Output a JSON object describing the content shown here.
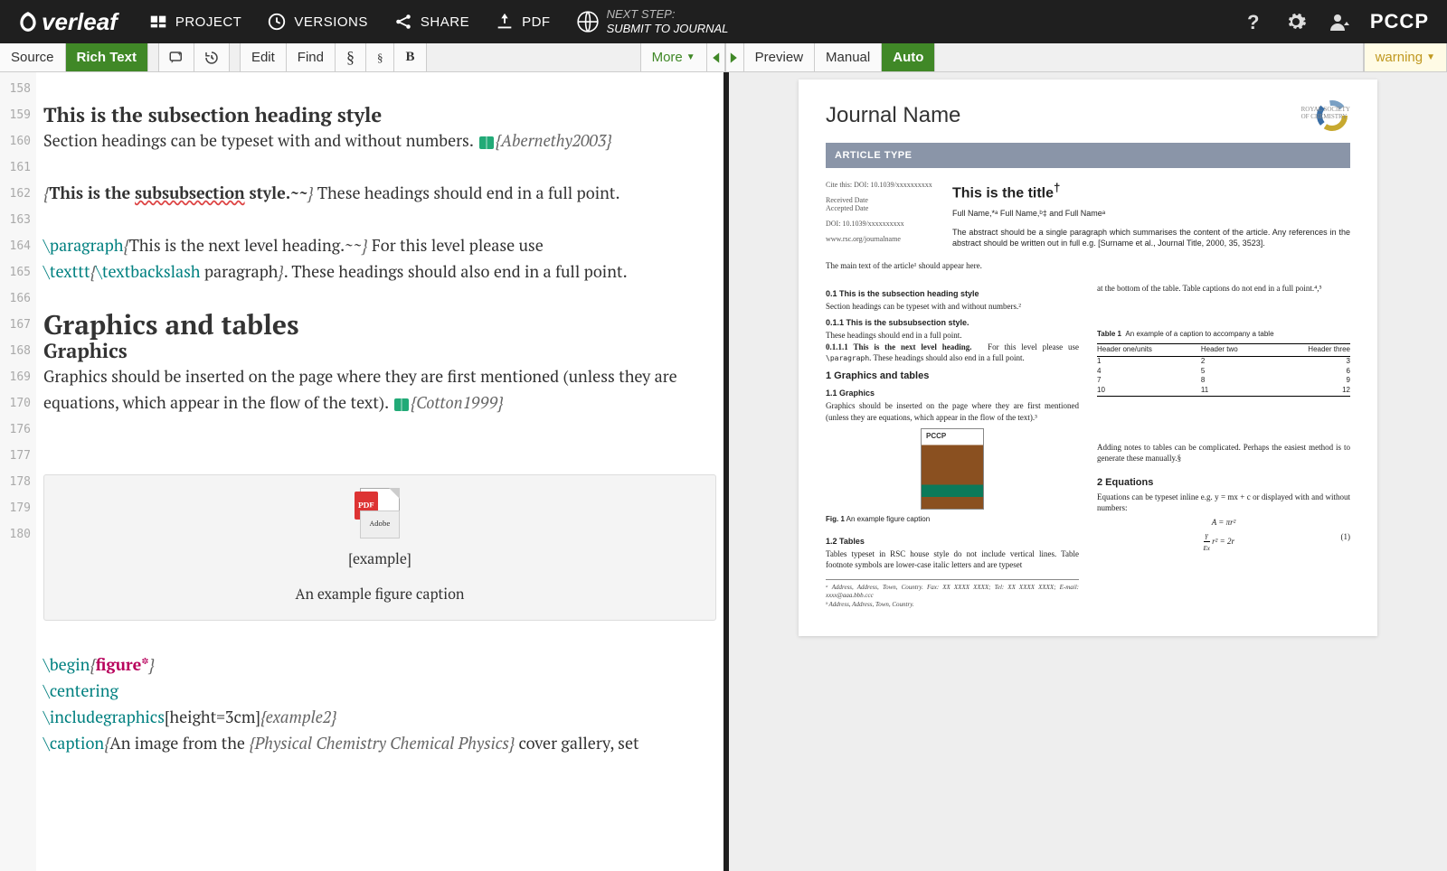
{
  "topbar": {
    "logo": "verleaf",
    "project": "PROJECT",
    "versions": "VERSIONS",
    "share": "SHARE",
    "pdf": "PDF",
    "nextstep_label": "NEXT STEP:",
    "nextstep_action": "SUBMIT TO JOURNAL",
    "brand": "PCCP"
  },
  "toolbar": {
    "source": "Source",
    "richtext": "Rich Text",
    "edit": "Edit",
    "find": "Find",
    "sec": "§",
    "sub": "§",
    "bold": "B",
    "more": "More",
    "preview": "Preview",
    "manual": "Manual",
    "auto": "Auto",
    "warning": "warning"
  },
  "gutter": [
    "158",
    "159",
    "160",
    "161",
    "162",
    "163",
    "164",
    "",
    "165",
    "166",
    "167",
    "168",
    "",
    "169",
    "170",
    "",
    "",
    "",
    "",
    "",
    "176",
    "177",
    "178",
    "179",
    "180"
  ],
  "editor": {
    "l159": "This is the subsection heading style",
    "l160a": "Section headings can be typeset with and without numbers. ",
    "l160b": "{Abernethy2003}",
    "l162a": "{",
    "l162b": "This is the ",
    "l162c": "subsubsection",
    "l162d": " style.~~",
    "l162e": "}",
    "l162f": " These headings should end in a full point.",
    "l164a": "\\paragraph",
    "l164b": "{",
    "l164c": "This is the next level heading.~~",
    "l164d": "}",
    "l164e": " For this level please use ",
    "l164f": "\\texttt",
    "l164g": "{",
    "l164h": "\\textbackslash",
    "l164i": " paragraph",
    "l164j": "}",
    "l164k": ". These headings should also end in a full point.",
    "l166": "Graphics and tables",
    "l167": "Graphics",
    "l168a": "Graphics should be inserted on the page where they are first mentioned (unless they are equations, which appear in the flow of the text). ",
    "l168b": "{Cotton1999}",
    "fig_name": "[example]",
    "fig_caption": "An example figure caption",
    "l177a": "\\begin",
    "l177b": "{",
    "l177c": "figure*",
    "l177d": "}",
    "l178": " \\centering",
    "l179a": " \\includegraphics",
    "l179b": "[height=3cm]",
    "l179c": "{example2}",
    "l180a": " \\caption",
    "l180b": "{",
    "l180c": "An image from the ",
    "l180d": "{Physical Chemistry Chemical Physics}",
    "l180e": " cover gallery, set"
  },
  "preview": {
    "journal_name": "Journal Name",
    "rsc1": "ROYAL SOCIETY",
    "rsc2": "OF CHEMISTRY",
    "article_type": "ARTICLE TYPE",
    "cite": "Cite this: DOI: 10.1039/xxxxxxxxxx",
    "received": "Received Date",
    "accepted": "Accepted Date",
    "doi": "DOI: 10.1039/xxxxxxxxxx",
    "url": "www.rsc.org/journalname",
    "title": "This is the title",
    "title_dag": "†",
    "authors": "Full Name,*ᵃ Full Name,ᵇ‡ and Full Nameᵃ",
    "abstract": "The abstract should be a single paragraph which summarises the content of the article. Any references in the abstract should be written out in full e.g. [Surname et al., Journal Title, 2000, 35, 3523].",
    "intro": "The main text of the article¹ should appear here.",
    "s01": "0.1   This is the subsection heading style",
    "s01t": "Section headings can be typeset with and without numbers.²",
    "s011": "0.1.1   This is the subsubsection style.",
    "s011t": "These headings should end in a full point.",
    "s0111a": "0.1.1.1   This is the next level heading.",
    "s0111b": "For this level please use ",
    "s0111c": "\\paragraph",
    "s0111d": ". These headings should also end in a full point.",
    "s1": "1    Graphics and tables",
    "s11": "1.1   Graphics",
    "s11t": "Graphics should be inserted on the page where they are first mentioned (unless they are equations, which appear in the flow of the text).³",
    "figcap": "Fig. 1 An example figure caption",
    "s12": "1.2   Tables",
    "s12t": "Tables typeset in RSC house style do not include vertical lines. Table footnote symbols are lower-case italic letters and are typeset",
    "col2_top": "at the bottom of the table. Table captions do not end in a full point.⁴,⁵",
    "tabcap": "Table 1   An example of a caption to accompany a table",
    "th1": "Header one/units",
    "th2": "Header two",
    "th3": "Header three",
    "r1c1": "1",
    "r1c2": "2",
    "r1c3": "3",
    "r2c1": "4",
    "r2c2": "5",
    "r2c3": "6",
    "r3c1": "7",
    "r3c2": "8",
    "r3c3": "9",
    "r4c1": "10",
    "r4c2": "11",
    "r4c3": "12",
    "notes": "Adding notes to tables can be complicated. Perhaps the easiest method is to generate these manually.§",
    "s2": "2    Equations",
    "s2t": "Equations can be typeset inline e.g.  y = mx + c or displayed with and without numbers:",
    "eq1": "A = πr²",
    "eq2a": "γ",
    "eq2b": "Ex",
    "eq2c": "r² = 2r",
    "eq2n": "(1)",
    "fn1": "ᵃ Address, Address, Town, Country. Fax: XX XXXX XXXX; Tel: XX XXXX XXXX; E-mail: xxxx@aaa.bbb.ccc",
    "fn2": "ᵇ Address, Address, Town, Country."
  }
}
